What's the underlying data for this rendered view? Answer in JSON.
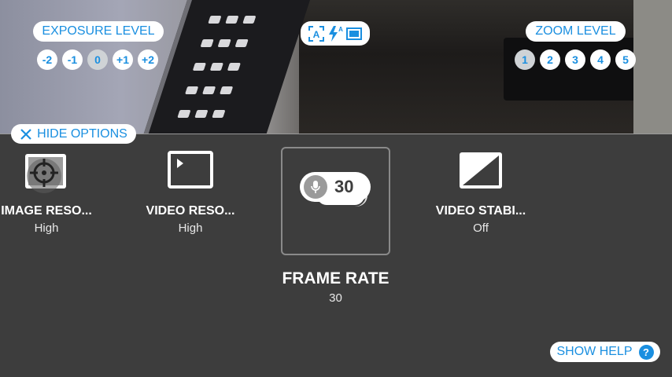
{
  "exposure": {
    "title": "EXPOSURE LEVEL",
    "levels": [
      "-2",
      "-1",
      "0",
      "+1",
      "+2"
    ],
    "selected": "0"
  },
  "zoom": {
    "title": "ZOOM LEVEL",
    "levels": [
      "1",
      "2",
      "3",
      "4",
      "5"
    ],
    "selected": "1"
  },
  "mode_icons": [
    "auto-focus-icon",
    "flash-auto-icon",
    "aspect-ratio-icon"
  ],
  "hide_options": {
    "label": "HIDE OPTIONS",
    "icon": "close-icon"
  },
  "options": [
    {
      "label": "IMAGE RESO...",
      "value": "High",
      "icon": "image-resolution-icon"
    },
    {
      "label": "VIDEO RESO...",
      "value": "High",
      "icon": "video-resolution-icon"
    },
    {
      "label": "FRAME RATE",
      "value": "30",
      "badge": "30",
      "icon": "microphone-icon",
      "selected": true
    },
    {
      "label": "VIDEO STABI...",
      "value": "Off",
      "icon": "stabilization-icon"
    }
  ],
  "help": {
    "label": "SHOW HELP",
    "icon": "help-icon",
    "icon_text": "?"
  },
  "colors": {
    "accent": "#1a8fe0",
    "panel": "#3d3d3d",
    "selected_circle": "#cfd3d6"
  }
}
